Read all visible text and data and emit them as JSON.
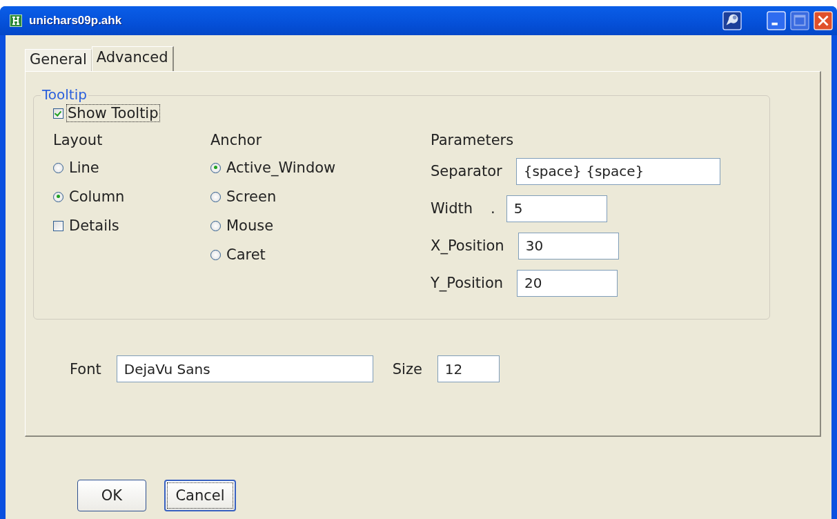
{
  "window": {
    "title": "unichars09p.ahk"
  },
  "tabs": [
    {
      "label": "General",
      "selected": false
    },
    {
      "label": "Advanced",
      "selected": true
    }
  ],
  "tooltip_group": {
    "title": "Tooltip",
    "show_tooltip": {
      "label": "Show Tooltip",
      "checked": true,
      "focused": true
    },
    "layout": {
      "heading": "Layout",
      "options": [
        {
          "kind": "radio",
          "label": "Line",
          "selected": false
        },
        {
          "kind": "radio",
          "label": "Column",
          "selected": true
        },
        {
          "kind": "checkbox",
          "label": "Details",
          "checked": false
        }
      ]
    },
    "anchor": {
      "heading": "Anchor",
      "options": [
        {
          "kind": "radio",
          "label": "Active_Window",
          "selected": true
        },
        {
          "kind": "radio",
          "label": "Screen",
          "selected": false
        },
        {
          "kind": "radio",
          "label": "Mouse",
          "selected": false
        },
        {
          "kind": "radio",
          "label": "Caret",
          "selected": false
        }
      ]
    },
    "parameters": {
      "heading": "Parameters",
      "fields": [
        {
          "label": "Separator",
          "value": "{space} {space}"
        },
        {
          "label": "Width",
          "suffix": ".",
          "value": "5"
        },
        {
          "label": "X_Position",
          "value": "30"
        },
        {
          "label": "Y_Position",
          "value": "20"
        }
      ]
    }
  },
  "font": {
    "label": "Font",
    "value": "DejaVu Sans"
  },
  "size": {
    "label": "Size",
    "value": "12"
  },
  "buttons": [
    {
      "label": "OK",
      "focused": false
    },
    {
      "label": "Cancel",
      "focused": true
    }
  ]
}
